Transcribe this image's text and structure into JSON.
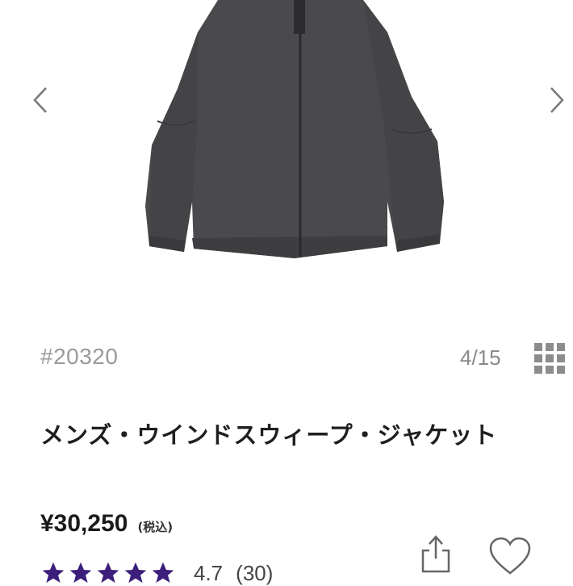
{
  "gallery": {
    "image_alt": "Men's Windsweep Jacket product photo",
    "prev_icon": "chevron-left-icon",
    "next_icon": "chevron-right-icon"
  },
  "product": {
    "sku": "#20320",
    "image_counter": "4/15",
    "title": "メンズ・ウインドスウィープ・ジャケット",
    "price": "¥30,250",
    "tax_label": "(税込)",
    "rating_value": "4.7",
    "rating_count": "(30)"
  },
  "icons": {
    "grid": "grid-icon",
    "share": "share-icon",
    "favorite": "heart-icon",
    "star": "star-icon"
  },
  "colors": {
    "star": "#3b1f7a",
    "jacket": "#4a4a4d",
    "muted_text": "#9a9a9a"
  }
}
